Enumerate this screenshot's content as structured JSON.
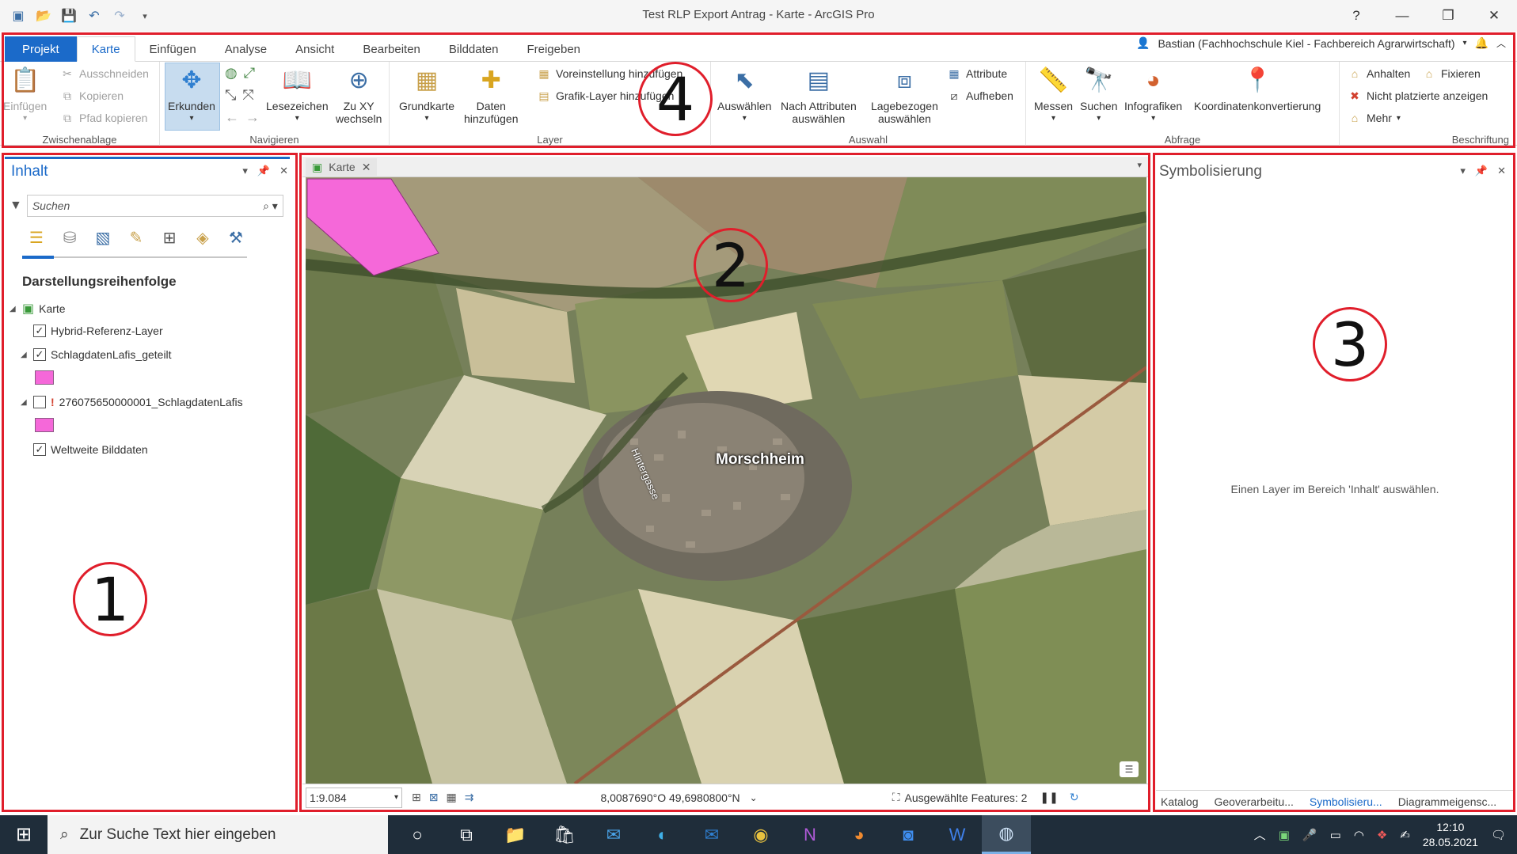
{
  "window": {
    "title": "Test RLP Export Antrag - Karte - ArcGIS Pro",
    "help": "?",
    "minimize": "—",
    "restore": "❐",
    "close": "✕"
  },
  "ribbon_tabs": [
    {
      "label": "Projekt"
    },
    {
      "label": "Karte"
    },
    {
      "label": "Einfügen"
    },
    {
      "label": "Analyse"
    },
    {
      "label": "Ansicht"
    },
    {
      "label": "Bearbeiten"
    },
    {
      "label": "Bilddaten"
    },
    {
      "label": "Freigeben"
    }
  ],
  "user": {
    "name": "Bastian (Fachhochschule Kiel - Fachbereich Agrarwirtschaft)"
  },
  "ribbon": {
    "zwischenablage": {
      "label": "Zwischenablage",
      "einfuegen": "Einfügen",
      "ausschneiden": "Ausschneiden",
      "kopieren": "Kopieren",
      "pfad_kopieren": "Pfad kopieren"
    },
    "navigieren": {
      "label": "Navigieren",
      "erkunden": "Erkunden",
      "lesezeichen": "Lesezeichen",
      "zu_xy_1": "Zu XY",
      "zu_xy_2": "wechseln"
    },
    "layer": {
      "label": "Layer",
      "grundkarte": "Grundkarte",
      "daten_1": "Daten",
      "daten_2": "hinzufügen",
      "voreinstellung": "Voreinstellung hinzufügen",
      "grafik_layer": "Grafik-Layer hinzufügen"
    },
    "auswahl": {
      "label": "Auswahl",
      "auswaehlen": "Auswählen",
      "nach_attr_1": "Nach Attributen",
      "nach_attr_2": "auswählen",
      "lage_1": "Lagebezogen",
      "lage_2": "auswählen",
      "attribute": "Attribute",
      "aufheben": "Aufheben"
    },
    "abfrage": {
      "label": "Abfrage",
      "messen": "Messen",
      "suchen": "Suchen",
      "infografiken": "Infografiken",
      "koordinaten": "Koordinatenkonvertierung"
    },
    "beschriftung": {
      "label": "Beschriftung",
      "anhalten": "Anhalten",
      "fixieren": "Fixieren",
      "nicht_platziert": "Nicht platzierte anzeigen",
      "mehr": "Mehr"
    }
  },
  "contents": {
    "title": "Inhalt",
    "search_placeholder": "Suchen",
    "section": "Darstellungsreihenfolge",
    "map_name": "Karte",
    "layers": [
      {
        "name": "Hybrid-Referenz-Layer",
        "checked": true
      },
      {
        "name": "SchlagdatenLafis_geteilt",
        "checked": true
      },
      {
        "name": "276075650000001_SchlagdatenLafis",
        "checked": false
      },
      {
        "name": "Weltweite Bilddaten",
        "checked": true
      }
    ],
    "swatch_color": "#f568d9"
  },
  "map": {
    "tab_label": "Karte",
    "place_label": "Morschheim",
    "street_label": "Hintergasse",
    "scale": "1:9.084",
    "coordinates": "8,0087690°O 49,6980800°N",
    "selected_features": "Ausgewählte Features: 2"
  },
  "symbology": {
    "title": "Symbolisierung",
    "message": "Einen Layer im Bereich 'Inhalt' auswählen.",
    "bottom_tabs": [
      {
        "label": "Katalog"
      },
      {
        "label": "Geoverarbeitu..."
      },
      {
        "label": "Symbolisieru..."
      },
      {
        "label": "Diagrammeigensc..."
      }
    ]
  },
  "annotations": {
    "n1": "1",
    "n2": "2",
    "n3": "3",
    "n4": "4"
  },
  "taskbar": {
    "search_placeholder": "Zur Suche Text hier eingeben",
    "time": "12:10",
    "date": "28.05.2021"
  },
  "colors": {
    "accent": "#1b6ac9",
    "frame_red": "#e01e2b",
    "taskbar": "#1f2d3a"
  }
}
